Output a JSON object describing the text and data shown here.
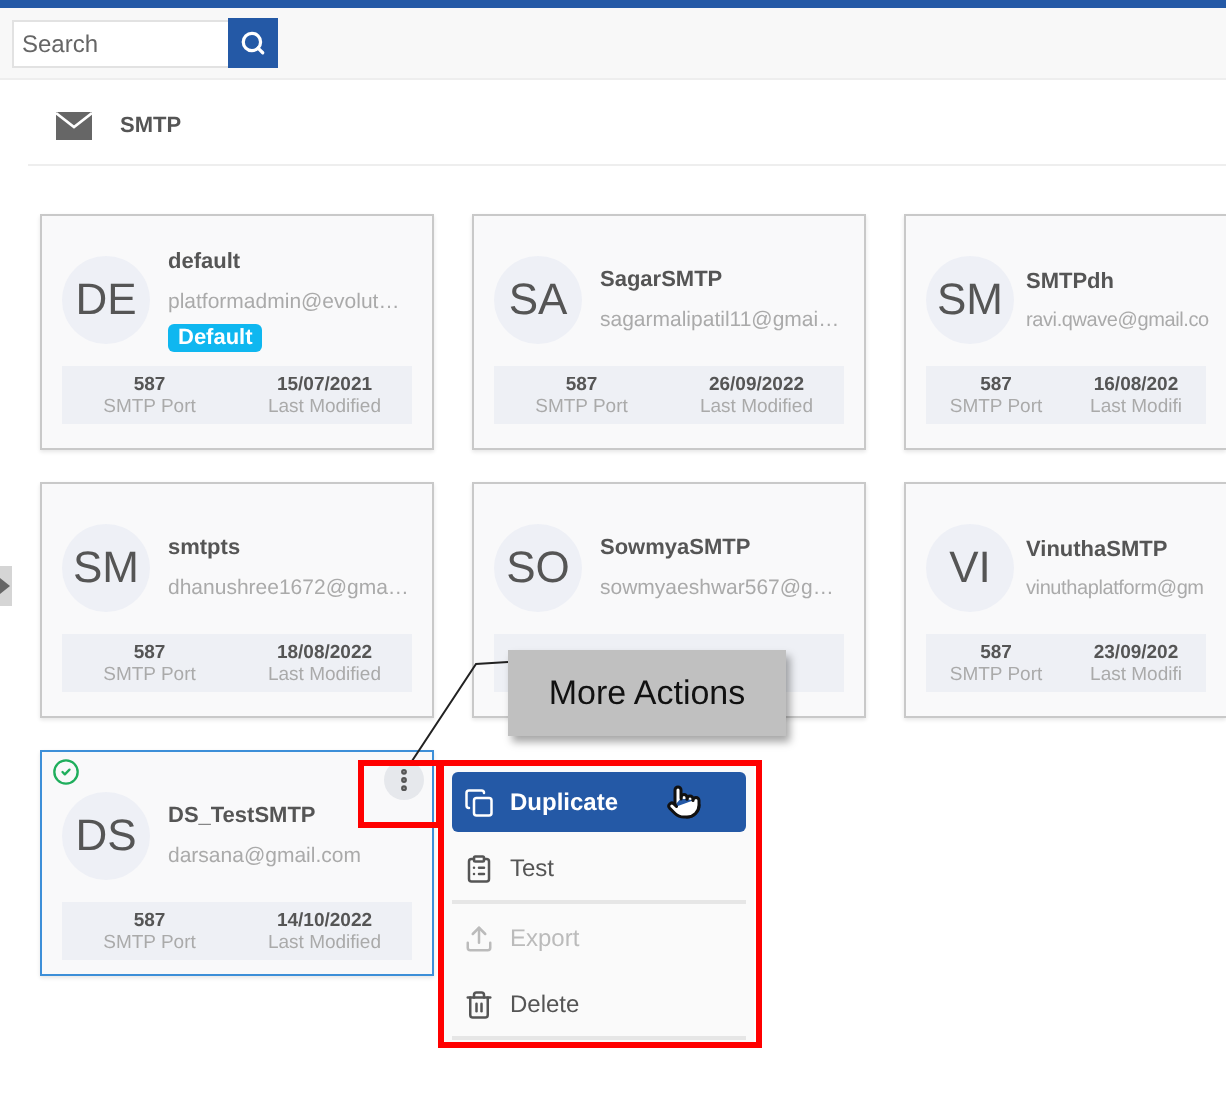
{
  "search": {
    "placeholder": "Search"
  },
  "section": {
    "title": "SMTP"
  },
  "cards": [
    {
      "initials": "DE",
      "name": "default",
      "email": "platformadmin@evolut…",
      "badge": "Default",
      "port": "587",
      "port_label": "SMTP Port",
      "date": "15/07/2021",
      "date_label": "Last Modified",
      "selected": false,
      "clipped": false
    },
    {
      "initials": "SA",
      "name": "SagarSMTP",
      "email": "sagarmalipatil11@gmai…",
      "port": "587",
      "port_label": "SMTP Port",
      "date": "26/09/2022",
      "date_label": "Last Modified",
      "selected": false,
      "clipped": false
    },
    {
      "initials": "SM",
      "name": "SMTPdh",
      "email": "ravi.qwave@gmail.co",
      "port": "587",
      "port_label": "SMTP Port",
      "date": "16/08/202",
      "date_label": "Last Modifi",
      "selected": false,
      "clipped": true
    },
    {
      "initials": "SM",
      "name": "smtpts",
      "email": "dhanushree1672@gma…",
      "port": "587",
      "port_label": "SMTP Port",
      "date": "18/08/2022",
      "date_label": "Last Modified",
      "selected": false,
      "clipped": false
    },
    {
      "initials": "SO",
      "name": "SowmyaSMTP",
      "email": "sowmyaeshwar567@g…",
      "selected": false,
      "clipped": false
    },
    {
      "initials": "VI",
      "name": "VinuthaSMTP",
      "email": "vinuthaplatform@gm",
      "port": "587",
      "port_label": "SMTP Port",
      "date": "23/09/202",
      "date_label": "Last Modifi",
      "selected": false,
      "clipped": true
    },
    {
      "initials": "DS",
      "name": "DS_TestSMTP",
      "email": "darsana@gmail.com",
      "port": "587",
      "port_label": "SMTP Port",
      "date": "14/10/2022",
      "date_label": "Last Modified",
      "selected": true,
      "clipped": false
    }
  ],
  "tooltip": {
    "text": "More Actions"
  },
  "menu": {
    "items": [
      {
        "kind": "duplicate",
        "label": "Duplicate",
        "selected": true,
        "disabled": false,
        "divider_after": false
      },
      {
        "kind": "test",
        "label": "Test",
        "selected": false,
        "disabled": false,
        "divider_after": true
      },
      {
        "kind": "export",
        "label": "Export",
        "selected": false,
        "disabled": true,
        "divider_after": false
      },
      {
        "kind": "delete",
        "label": "Delete",
        "selected": false,
        "disabled": false,
        "divider_after": true
      }
    ]
  }
}
